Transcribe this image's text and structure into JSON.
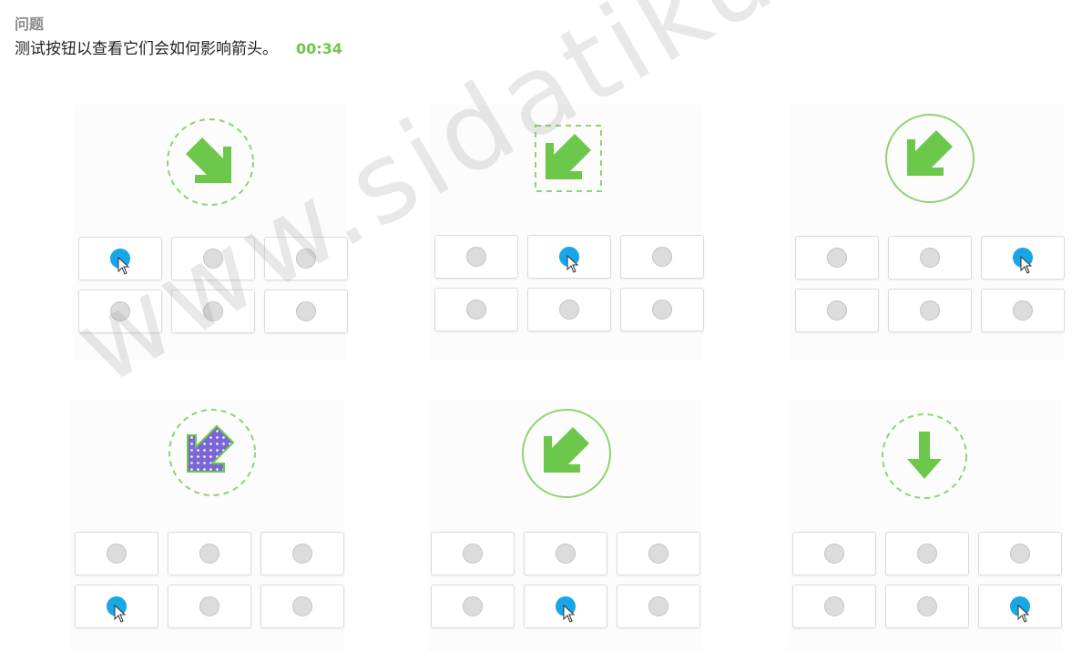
{
  "question": {
    "title": "问题",
    "text": "测试按钮以查看它们会如何影响箭头。",
    "timer": "00:34"
  },
  "colors": {
    "arrow_green": "#6cc84a",
    "active_dot": "#17a7e6",
    "inactive_dot": "#dcdcdc",
    "purple_arrow": "#7b66d6"
  },
  "panels": [
    {
      "arrow": "arrow-down-right-icon",
      "frame": "dashed-circle",
      "active_button": 1
    },
    {
      "arrow": "arrow-down-left-icon",
      "frame": "dashed-square",
      "active_button": 2
    },
    {
      "arrow": "arrow-down-left-icon",
      "frame": "solid-circle",
      "active_button": 3
    },
    {
      "arrow": "arrow-down-left-dotted-purple-icon",
      "frame": "dashed-circle",
      "active_button": 4
    },
    {
      "arrow": "arrow-down-left-icon",
      "frame": "solid-circle",
      "active_button": 5
    },
    {
      "arrow": "arrow-down-icon",
      "frame": "dashed-circle",
      "active_button": 6
    }
  ],
  "watermark": "www.sidatiku.com"
}
